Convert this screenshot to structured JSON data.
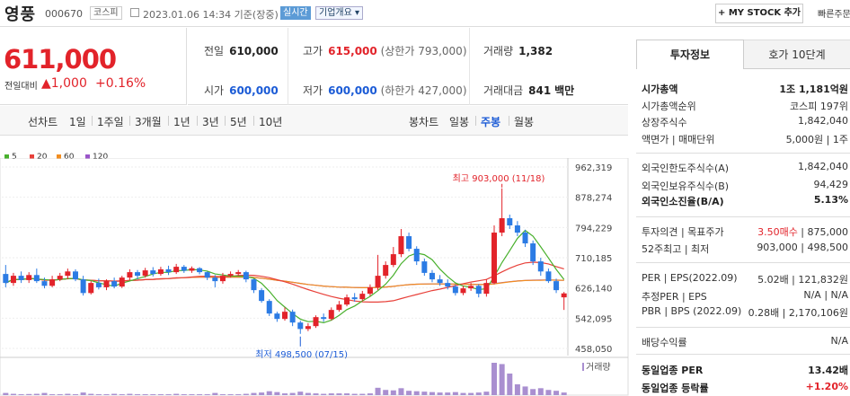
{
  "header": {
    "name": "영풍",
    "code": "000670",
    "market": "코스피",
    "datetime": "2023.01.06 14:34 기준(장중)",
    "realtime_badge": "실시간",
    "overview_select": "기업개요 ▾",
    "mystock_button": "+ MY STOCK 추가",
    "quick_order": "빠른주문"
  },
  "quote": {
    "price": "611,000",
    "change_label": "전일대비",
    "change": "▲1,000",
    "change_pct": "+0.16%"
  },
  "stats": {
    "prev_close_label": "전일",
    "prev_close": "610,000",
    "high_label": "고가",
    "high": "615,000",
    "upper_limit": "(상한가 793,000)",
    "volume_label": "거래량",
    "volume": "1,382",
    "open_label": "시가",
    "open": "600,000",
    "low_label": "저가",
    "low": "600,000",
    "lower_limit": "(하한가 427,000)",
    "amount_label": "거래대금",
    "amount": "841",
    "amount_unit": "백만"
  },
  "period_bar": {
    "line_label": "선차트",
    "line_items": [
      "1일",
      "1주일",
      "3개월",
      "1년",
      "3년",
      "5년",
      "10년"
    ],
    "candle_label": "봉차트",
    "candle_items": [
      "일봉",
      "주봉",
      "월봉"
    ],
    "candle_selected": "주봉"
  },
  "chart_data": {
    "type": "candlestick",
    "interval": "weekly",
    "moving_averages": [
      {
        "name": "5",
        "color": "#48b02c"
      },
      {
        "name": "20",
        "color": "#e8413a"
      },
      {
        "name": "60",
        "color": "#f28d1f"
      },
      {
        "name": "120",
        "color": "#9a55c9"
      }
    ],
    "y_ticks": [
      962319,
      878274,
      794229,
      710185,
      626140,
      542095,
      458050
    ],
    "ylim": [
      458050,
      962319
    ],
    "annotations": {
      "high": "최고 903,000 (11/18)",
      "low": "최저 498,500 (07/15)"
    },
    "volume_label": "거래량",
    "colors": {
      "up": "#e2232a",
      "down": "#2b7be4"
    },
    "candles": [
      {
        "o": 665000,
        "c": 640000,
        "h": 690000,
        "l": 628000
      },
      {
        "o": 640000,
        "c": 660000,
        "h": 668000,
        "l": 632000
      },
      {
        "o": 660000,
        "c": 648000,
        "h": 672000,
        "l": 640000
      },
      {
        "o": 648000,
        "c": 662000,
        "h": 670000,
        "l": 640000
      },
      {
        "o": 662000,
        "c": 645000,
        "h": 680000,
        "l": 640000
      },
      {
        "o": 645000,
        "c": 632000,
        "h": 655000,
        "l": 625000
      },
      {
        "o": 632000,
        "c": 650000,
        "h": 660000,
        "l": 628000
      },
      {
        "o": 650000,
        "c": 660000,
        "h": 668000,
        "l": 645000
      },
      {
        "o": 660000,
        "c": 672000,
        "h": 680000,
        "l": 650000
      },
      {
        "o": 672000,
        "c": 650000,
        "h": 678000,
        "l": 645000
      },
      {
        "o": 650000,
        "c": 612000,
        "h": 660000,
        "l": 605000
      },
      {
        "o": 612000,
        "c": 640000,
        "h": 646000,
        "l": 608000
      },
      {
        "o": 640000,
        "c": 628000,
        "h": 652000,
        "l": 622000
      },
      {
        "o": 628000,
        "c": 645000,
        "h": 650000,
        "l": 620000
      },
      {
        "o": 645000,
        "c": 630000,
        "h": 655000,
        "l": 625000
      },
      {
        "o": 630000,
        "c": 655000,
        "h": 660000,
        "l": 626000
      },
      {
        "o": 655000,
        "c": 670000,
        "h": 678000,
        "l": 648000
      },
      {
        "o": 670000,
        "c": 660000,
        "h": 676000,
        "l": 650000
      },
      {
        "o": 660000,
        "c": 675000,
        "h": 682000,
        "l": 655000
      },
      {
        "o": 675000,
        "c": 665000,
        "h": 684000,
        "l": 658000
      },
      {
        "o": 665000,
        "c": 678000,
        "h": 685000,
        "l": 660000
      },
      {
        "o": 678000,
        "c": 670000,
        "h": 688000,
        "l": 662000
      },
      {
        "o": 670000,
        "c": 685000,
        "h": 693000,
        "l": 665000
      },
      {
        "o": 685000,
        "c": 674000,
        "h": 690000,
        "l": 668000
      },
      {
        "o": 674000,
        "c": 681000,
        "h": 686000,
        "l": 668000
      },
      {
        "o": 681000,
        "c": 670000,
        "h": 684000,
        "l": 664000
      },
      {
        "o": 670000,
        "c": 655000,
        "h": 672000,
        "l": 648000
      },
      {
        "o": 655000,
        "c": 645000,
        "h": 662000,
        "l": 628000
      },
      {
        "o": 645000,
        "c": 660000,
        "h": 668000,
        "l": 638000
      },
      {
        "o": 660000,
        "c": 665000,
        "h": 672000,
        "l": 655000
      },
      {
        "o": 665000,
        "c": 670000,
        "h": 676000,
        "l": 660000
      },
      {
        "o": 670000,
        "c": 650000,
        "h": 674000,
        "l": 642000
      },
      {
        "o": 650000,
        "c": 620000,
        "h": 652000,
        "l": 612000
      },
      {
        "o": 620000,
        "c": 590000,
        "h": 625000,
        "l": 585000
      },
      {
        "o": 590000,
        "c": 555000,
        "h": 595000,
        "l": 548000
      },
      {
        "o": 555000,
        "c": 540000,
        "h": 560000,
        "l": 532000
      },
      {
        "o": 540000,
        "c": 560000,
        "h": 572000,
        "l": 535000
      },
      {
        "o": 560000,
        "c": 530000,
        "h": 566000,
        "l": 520000
      },
      {
        "o": 530000,
        "c": 512000,
        "h": 535000,
        "l": 498500
      },
      {
        "o": 512000,
        "c": 520000,
        "h": 528000,
        "l": 506000
      },
      {
        "o": 520000,
        "c": 545000,
        "h": 550000,
        "l": 515000
      },
      {
        "o": 545000,
        "c": 540000,
        "h": 555000,
        "l": 532000
      },
      {
        "o": 540000,
        "c": 565000,
        "h": 572000,
        "l": 536000
      },
      {
        "o": 565000,
        "c": 580000,
        "h": 590000,
        "l": 560000
      },
      {
        "o": 580000,
        "c": 600000,
        "h": 608000,
        "l": 575000
      },
      {
        "o": 600000,
        "c": 595000,
        "h": 612000,
        "l": 588000
      },
      {
        "o": 595000,
        "c": 610000,
        "h": 618000,
        "l": 590000
      },
      {
        "o": 610000,
        "c": 628000,
        "h": 636000,
        "l": 604000
      },
      {
        "o": 628000,
        "c": 660000,
        "h": 718000,
        "l": 620000
      },
      {
        "o": 660000,
        "c": 690000,
        "h": 700000,
        "l": 652000
      },
      {
        "o": 690000,
        "c": 720000,
        "h": 740000,
        "l": 684000
      },
      {
        "o": 720000,
        "c": 770000,
        "h": 790000,
        "l": 712000
      },
      {
        "o": 770000,
        "c": 735000,
        "h": 780000,
        "l": 728000
      },
      {
        "o": 735000,
        "c": 700000,
        "h": 742000,
        "l": 690000
      },
      {
        "o": 700000,
        "c": 668000,
        "h": 708000,
        "l": 660000
      },
      {
        "o": 668000,
        "c": 650000,
        "h": 676000,
        "l": 642000
      },
      {
        "o": 650000,
        "c": 640000,
        "h": 662000,
        "l": 632000
      },
      {
        "o": 640000,
        "c": 630000,
        "h": 650000,
        "l": 622000
      },
      {
        "o": 630000,
        "c": 612000,
        "h": 636000,
        "l": 605000
      },
      {
        "o": 612000,
        "c": 625000,
        "h": 632000,
        "l": 606000
      },
      {
        "o": 625000,
        "c": 632000,
        "h": 640000,
        "l": 618000
      },
      {
        "o": 632000,
        "c": 610000,
        "h": 636000,
        "l": 600000
      },
      {
        "o": 610000,
        "c": 640000,
        "h": 650000,
        "l": 602000
      },
      {
        "o": 640000,
        "c": 780000,
        "h": 800000,
        "l": 636000
      },
      {
        "o": 780000,
        "c": 820000,
        "h": 903000,
        "l": 770000
      },
      {
        "o": 820000,
        "c": 800000,
        "h": 830000,
        "l": 790000
      },
      {
        "o": 800000,
        "c": 780000,
        "h": 812000,
        "l": 770000
      },
      {
        "o": 780000,
        "c": 750000,
        "h": 788000,
        "l": 740000
      },
      {
        "o": 750000,
        "c": 700000,
        "h": 758000,
        "l": 690000
      },
      {
        "o": 700000,
        "c": 672000,
        "h": 710000,
        "l": 660000
      },
      {
        "o": 672000,
        "c": 645000,
        "h": 680000,
        "l": 640000
      },
      {
        "o": 645000,
        "c": 620000,
        "h": 652000,
        "l": 612000
      },
      {
        "o": 600000,
        "c": 611000,
        "h": 615000,
        "l": 565000
      }
    ],
    "volumes": [
      0.5,
      0.3,
      0.2,
      0.25,
      0.3,
      0.5,
      0.2,
      0.2,
      0.3,
      0.2,
      0.6,
      0.3,
      0.2,
      0.2,
      0.3,
      0.2,
      0.3,
      0.2,
      0.2,
      0.2,
      0.2,
      0.2,
      0.3,
      0.2,
      0.2,
      0.2,
      0.2,
      0.5,
      0.2,
      0.2,
      0.2,
      0.3,
      0.5,
      0.6,
      0.9,
      0.7,
      0.4,
      0.5,
      0.8,
      0.5,
      0.4,
      0.3,
      0.4,
      0.4,
      0.4,
      0.3,
      0.3,
      0.4,
      1.7,
      1.2,
      1.1,
      1.6,
      1.0,
      0.9,
      0.8,
      0.7,
      0.6,
      0.6,
      0.7,
      0.5,
      0.5,
      0.6,
      0.8,
      7.5,
      7.2,
      5.0,
      2.5,
      2.0,
      1.4,
      1.6,
      1.2,
      1.0,
      0.6
    ]
  },
  "investment_panel": {
    "tab_info": "투자정보",
    "tab_quote": "호가 10단계",
    "rows": [
      {
        "k": "시가총액",
        "v": "1조 1,181억원",
        "bold": true
      },
      {
        "k": "시가총액순위",
        "v": "코스피 197위"
      },
      {
        "k": "상장주식수",
        "v": "1,842,040"
      },
      {
        "k": "액면가 | 매매단위",
        "v": "5,000원 | 1주"
      },
      {
        "k": "외국인한도주식수(A)",
        "v": "1,842,040"
      },
      {
        "k": "외국인보유주식수(B)",
        "v": "94,429"
      },
      {
        "k": "외국인소진율(B/A)",
        "v": "5.13%",
        "bold": true
      },
      {
        "k": "투자의견 | 목표주가",
        "v_red": "3.50매수",
        "v": " | 875,000"
      },
      {
        "k": "52주최고 | 최저",
        "v": "903,000 | 498,500"
      },
      {
        "k": "PER | EPS(2022.09)",
        "v": "5.02배 | 121,832원"
      },
      {
        "k": "추정PER | EPS",
        "v": "N/A | N/A"
      },
      {
        "k": "PBR | BPS (2022.09)",
        "v": "0.28배 | 2,170,106원"
      },
      {
        "k": "배당수익률",
        "v": "N/A"
      },
      {
        "k": "동일업종 PER",
        "v": "13.42배",
        "bold": true
      },
      {
        "k": "동일업종 등락률",
        "v": "+1.20%",
        "bold": true,
        "vcolor": "#e2232a"
      }
    ]
  }
}
